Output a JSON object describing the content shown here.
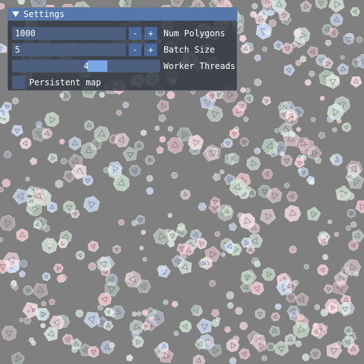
{
  "window": {
    "title": "Settings",
    "collapse_icon": "triangle-down-icon",
    "rows": {
      "num_polygons": {
        "value": "1000",
        "label": "Num Polygons",
        "minus": "-",
        "plus": "+"
      },
      "batch_size": {
        "value": "5",
        "label": "Batch Size",
        "minus": "-",
        "plus": "+"
      },
      "worker_threads": {
        "value": "4",
        "label": "Worker Threads"
      },
      "persistent_map": {
        "label": "Persistent map",
        "checked": false
      }
    }
  },
  "scene": {
    "background": "#808080",
    "polygon_colors": [
      "#ffd0d8",
      "#d0e8d4",
      "#d4e4ff",
      "#ffe4ea",
      "#e0f2e4"
    ]
  }
}
